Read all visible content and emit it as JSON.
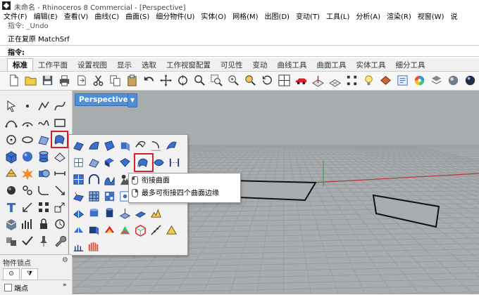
{
  "window": {
    "title": "未命名 - Rhinoceros 8 Commercial - [Perspective]"
  },
  "menu": [
    "文件(F)",
    "编辑(E)",
    "查看(V)",
    "曲线(C)",
    "曲面(S)",
    "细分物件(U)",
    "实体(O)",
    "网格(M)",
    "出图(D)",
    "变动(T)",
    "工具(L)",
    "分析(A)",
    "渲染(R)",
    "视窗(W)",
    "说"
  ],
  "command": {
    "history_1": "指令: _Undo",
    "history_2": "正在复原 MatchSrf",
    "prompt": "指令:"
  },
  "tabs": [
    "标准",
    "工作平面",
    "设置视图",
    "显示",
    "选取",
    "工作视窗配置",
    "可见性",
    "变动",
    "曲线工具",
    "曲面工具",
    "实体工具",
    "细分工具"
  ],
  "active_tab": "标准",
  "viewport": {
    "label": "Perspective",
    "dropdown_icon": "caret-down-icon"
  },
  "tooltip_menu": {
    "left_click": "衔接曲面",
    "right_click": "最多可衔接四个曲面边缘"
  },
  "osnap_panel": {
    "title": "物件锁点",
    "more": "»",
    "endpoint_label": "端点",
    "endpoint_checked": false
  },
  "colors": {
    "viewport_bg": "#a9acae",
    "grid_line": "#9a9d9f",
    "x_axis": "#b23a3a",
    "y_axis": "#3aa043",
    "viewport_label_bg": "#4f8fd6",
    "highlight": "#d9202a",
    "icon_blue": "#3b6fc9",
    "icon_gray": "#6b7380"
  }
}
